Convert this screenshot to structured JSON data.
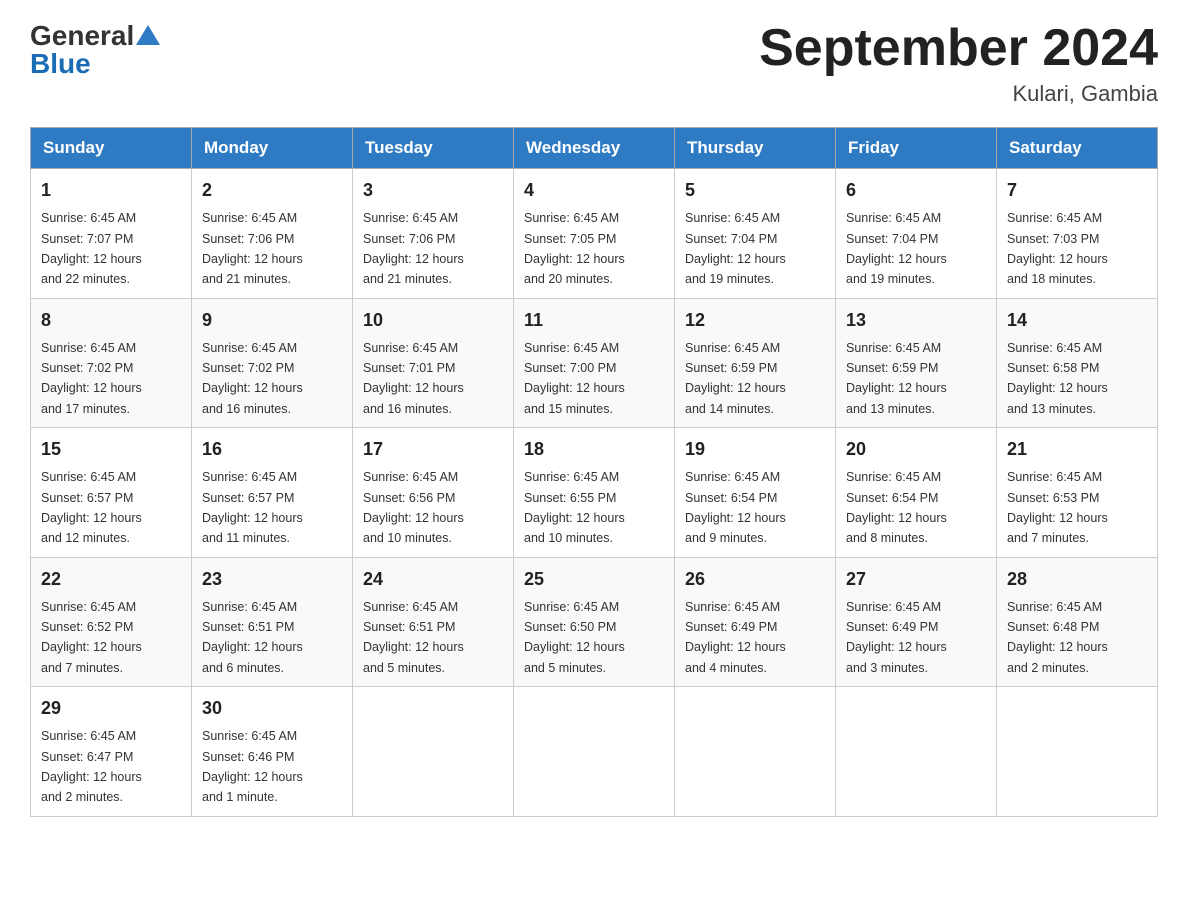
{
  "header": {
    "logo_general": "General",
    "logo_blue": "Blue",
    "month_year": "September 2024",
    "location": "Kulari, Gambia"
  },
  "days_of_week": [
    "Sunday",
    "Monday",
    "Tuesday",
    "Wednesday",
    "Thursday",
    "Friday",
    "Saturday"
  ],
  "weeks": [
    [
      {
        "day": "1",
        "sunrise": "6:45 AM",
        "sunset": "7:07 PM",
        "daylight": "12 hours and 22 minutes."
      },
      {
        "day": "2",
        "sunrise": "6:45 AM",
        "sunset": "7:06 PM",
        "daylight": "12 hours and 21 minutes."
      },
      {
        "day": "3",
        "sunrise": "6:45 AM",
        "sunset": "7:06 PM",
        "daylight": "12 hours and 21 minutes."
      },
      {
        "day": "4",
        "sunrise": "6:45 AM",
        "sunset": "7:05 PM",
        "daylight": "12 hours and 20 minutes."
      },
      {
        "day": "5",
        "sunrise": "6:45 AM",
        "sunset": "7:04 PM",
        "daylight": "12 hours and 19 minutes."
      },
      {
        "day": "6",
        "sunrise": "6:45 AM",
        "sunset": "7:04 PM",
        "daylight": "12 hours and 19 minutes."
      },
      {
        "day": "7",
        "sunrise": "6:45 AM",
        "sunset": "7:03 PM",
        "daylight": "12 hours and 18 minutes."
      }
    ],
    [
      {
        "day": "8",
        "sunrise": "6:45 AM",
        "sunset": "7:02 PM",
        "daylight": "12 hours and 17 minutes."
      },
      {
        "day": "9",
        "sunrise": "6:45 AM",
        "sunset": "7:02 PM",
        "daylight": "12 hours and 16 minutes."
      },
      {
        "day": "10",
        "sunrise": "6:45 AM",
        "sunset": "7:01 PM",
        "daylight": "12 hours and 16 minutes."
      },
      {
        "day": "11",
        "sunrise": "6:45 AM",
        "sunset": "7:00 PM",
        "daylight": "12 hours and 15 minutes."
      },
      {
        "day": "12",
        "sunrise": "6:45 AM",
        "sunset": "6:59 PM",
        "daylight": "12 hours and 14 minutes."
      },
      {
        "day": "13",
        "sunrise": "6:45 AM",
        "sunset": "6:59 PM",
        "daylight": "12 hours and 13 minutes."
      },
      {
        "day": "14",
        "sunrise": "6:45 AM",
        "sunset": "6:58 PM",
        "daylight": "12 hours and 13 minutes."
      }
    ],
    [
      {
        "day": "15",
        "sunrise": "6:45 AM",
        "sunset": "6:57 PM",
        "daylight": "12 hours and 12 minutes."
      },
      {
        "day": "16",
        "sunrise": "6:45 AM",
        "sunset": "6:57 PM",
        "daylight": "12 hours and 11 minutes."
      },
      {
        "day": "17",
        "sunrise": "6:45 AM",
        "sunset": "6:56 PM",
        "daylight": "12 hours and 10 minutes."
      },
      {
        "day": "18",
        "sunrise": "6:45 AM",
        "sunset": "6:55 PM",
        "daylight": "12 hours and 10 minutes."
      },
      {
        "day": "19",
        "sunrise": "6:45 AM",
        "sunset": "6:54 PM",
        "daylight": "12 hours and 9 minutes."
      },
      {
        "day": "20",
        "sunrise": "6:45 AM",
        "sunset": "6:54 PM",
        "daylight": "12 hours and 8 minutes."
      },
      {
        "day": "21",
        "sunrise": "6:45 AM",
        "sunset": "6:53 PM",
        "daylight": "12 hours and 7 minutes."
      }
    ],
    [
      {
        "day": "22",
        "sunrise": "6:45 AM",
        "sunset": "6:52 PM",
        "daylight": "12 hours and 7 minutes."
      },
      {
        "day": "23",
        "sunrise": "6:45 AM",
        "sunset": "6:51 PM",
        "daylight": "12 hours and 6 minutes."
      },
      {
        "day": "24",
        "sunrise": "6:45 AM",
        "sunset": "6:51 PM",
        "daylight": "12 hours and 5 minutes."
      },
      {
        "day": "25",
        "sunrise": "6:45 AM",
        "sunset": "6:50 PM",
        "daylight": "12 hours and 5 minutes."
      },
      {
        "day": "26",
        "sunrise": "6:45 AM",
        "sunset": "6:49 PM",
        "daylight": "12 hours and 4 minutes."
      },
      {
        "day": "27",
        "sunrise": "6:45 AM",
        "sunset": "6:49 PM",
        "daylight": "12 hours and 3 minutes."
      },
      {
        "day": "28",
        "sunrise": "6:45 AM",
        "sunset": "6:48 PM",
        "daylight": "12 hours and 2 minutes."
      }
    ],
    [
      {
        "day": "29",
        "sunrise": "6:45 AM",
        "sunset": "6:47 PM",
        "daylight": "12 hours and 2 minutes."
      },
      {
        "day": "30",
        "sunrise": "6:45 AM",
        "sunset": "6:46 PM",
        "daylight": "12 hours and 1 minute."
      },
      null,
      null,
      null,
      null,
      null
    ]
  ],
  "labels": {
    "sunrise_prefix": "Sunrise: ",
    "sunset_prefix": "Sunset: ",
    "daylight_prefix": "Daylight: "
  }
}
